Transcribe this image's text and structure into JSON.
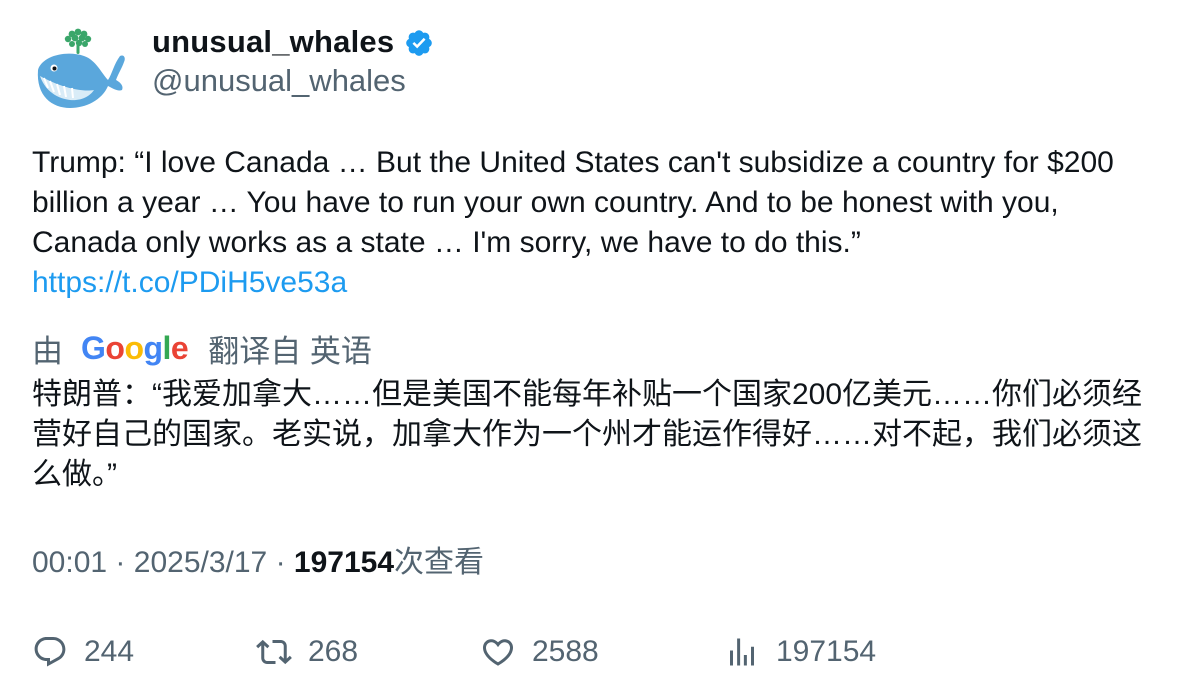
{
  "author": {
    "display_name": "unusual_whales",
    "handle": "@unusual_whales",
    "verified": true,
    "avatar_icon": "whale-icon"
  },
  "tweet": {
    "text": "Trump: “I love Canada … But the United States can't subsidize a country for $200 billion a year … You have to run your own country. And to be honest with you, Canada only works as a state … I'm sorry, we have to do this.”",
    "link": "https://t.co/PDiH5ve53a"
  },
  "translation": {
    "by_label": "由",
    "provider_letters": [
      "G",
      "o",
      "o",
      "g",
      "l",
      "e"
    ],
    "translated_from": "翻译自 英语",
    "text": "特朗普：“我爱加拿大……但是美国不能每年补贴一个国家200亿美元……你们必须经营好自己的国家。老实说，加拿大作为一个州才能运作得好……对不起，我们必须这么做。”"
  },
  "meta": {
    "time": "00:01",
    "separator": "·",
    "date": "2025/3/17",
    "views_count": "197154",
    "views_label": "次查看"
  },
  "actions": {
    "replies": "244",
    "retweets": "268",
    "likes": "2588",
    "views": "197154"
  },
  "colors": {
    "link": "#1d9bf0",
    "secondary_text": "#536471",
    "verified": "#1d9bf0",
    "whale_body": "#5aa7dc",
    "whale_spout": "#3aa66a"
  }
}
